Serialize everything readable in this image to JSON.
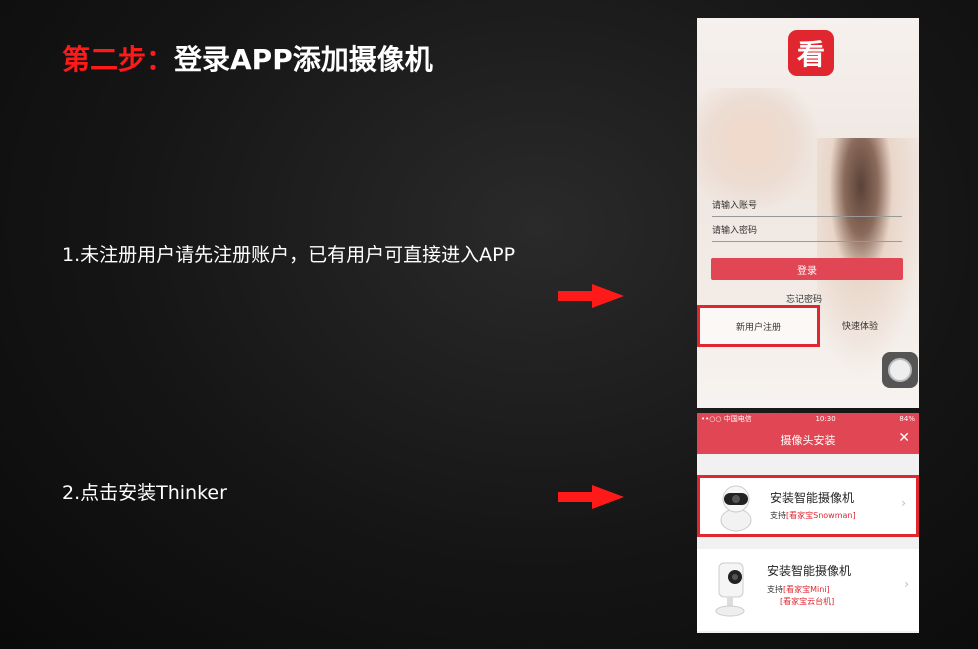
{
  "heading": {
    "step": "第二步：",
    "text": "登录APP添加摄像机"
  },
  "steps": [
    {
      "text": "1.未注册用户请先注册账户，已有用户可直接进入APP"
    },
    {
      "text": "2.点击安装Thinker"
    }
  ],
  "login_screen": {
    "app_icon_glyph": "看",
    "account_placeholder": "请输入账号",
    "password_placeholder": "请输入密码",
    "login_button": "登录",
    "forgot_password": "忘记密码",
    "register": "新用户注册",
    "quick_trial": "快速体验"
  },
  "install_screen": {
    "status_bar": {
      "carrier": "••○○ 中国电信",
      "time": "10:30",
      "battery": "84%"
    },
    "title": "摄像头安装",
    "close_icon": "close-icon",
    "cards": [
      {
        "title": "安装智能摄像机",
        "support_prefix": "支持",
        "support_items": [
          "[看家宝Snowman]"
        ]
      },
      {
        "title": "安装智能摄像机",
        "support_prefix": "支持",
        "support_items": [
          "[看家宝Mini]",
          "[看家宝云台机]"
        ]
      }
    ]
  },
  "colors": {
    "accent_red": "#e0262f",
    "app_red": "#e04653"
  }
}
